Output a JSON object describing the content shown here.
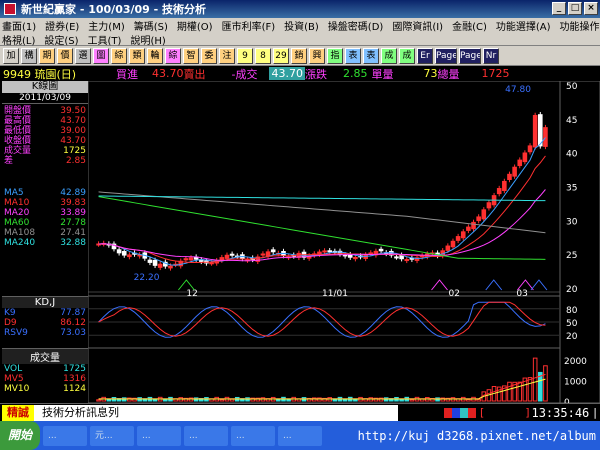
{
  "window": {
    "title": "新世紀贏家 - 100/03/09 - 技術分析"
  },
  "menu": {
    "row1": [
      "畫面(1)",
      "證券(E)",
      "主力(M)",
      "籌碼(S)",
      "期權(O)",
      "匯市利率(F)",
      "投資(B)",
      "操盤密碼(D)",
      "國際資訊(I)",
      "金融(C)",
      "功能選擇(A)",
      "功能操作(E)"
    ],
    "row2": [
      "格視(L)",
      "設定(S)",
      "工具(T)",
      "說明(H)"
    ]
  },
  "toolbar": {
    "buttons": [
      "加",
      "構",
      "期",
      "價",
      "選",
      "圖",
      "綜",
      "類",
      "輪",
      "綜",
      "智",
      "委",
      "注",
      "9",
      "8",
      "29",
      "銷",
      "興",
      "指",
      "表",
      "表",
      "成",
      "成",
      "Er",
      "Page",
      "Page",
      "Nr"
    ]
  },
  "quote": {
    "code_name": "9949 琉園(日)",
    "bid_label": "買進",
    "bid_value": "43.70",
    "ask_label": "賣出",
    "change": "-成交",
    "last": "43.70",
    "change_label": "漲跌",
    "change_value": "2.85",
    "volume_label": "單量",
    "volume_value": "73",
    "total_label": "總量",
    "total_value": "1725"
  },
  "info": {
    "kline_label": "K線圖",
    "date": "2011/03/09",
    "rows": [
      {
        "label": "開盤價",
        "value": "39.50"
      },
      {
        "label": "最高價",
        "value": "43.70"
      },
      {
        "label": "最低價",
        "value": "39.00"
      },
      {
        "label": "收盤價",
        "value": "43.70"
      },
      {
        "label": "成交量",
        "value": "1725"
      },
      {
        "label": "差",
        "value": "2.85"
      }
    ],
    "ma": [
      {
        "label": "MA5",
        "value": "42.89",
        "color": "#3aa0ff"
      },
      {
        "label": "MA10",
        "value": "39.83",
        "color": "#ff3030"
      },
      {
        "label": "MA20",
        "value": "33.89",
        "color": "#ff40ff"
      },
      {
        "label": "MA60",
        "value": "27.78",
        "color": "#30e030"
      },
      {
        "label": "MA108",
        "value": "27.41",
        "color": "#909090"
      },
      {
        "label": "MA240",
        "value": "32.88",
        "color": "#30e0e0"
      }
    ]
  },
  "kd": {
    "title": "KD,J",
    "rows": [
      {
        "label": "K9",
        "value": "77.87",
        "color": "#3a70ff"
      },
      {
        "label": "D9",
        "value": "86.12",
        "color": "#ff3030"
      },
      {
        "label": "RSV9",
        "value": "73.03",
        "color": "#3a70ff"
      }
    ],
    "axis": [
      "80",
      "50",
      "20"
    ]
  },
  "vol": {
    "title": "成交量",
    "rows": [
      {
        "label": "VOL",
        "value": "1725",
        "color": "#30e0e0"
      },
      {
        "label": "MV5",
        "value": "1316",
        "color": "#ff3030"
      },
      {
        "label": "MV10",
        "value": "1124",
        "color": "#ffff40"
      }
    ],
    "axis": [
      "2000",
      "1000",
      "0"
    ]
  },
  "price_axis": [
    "50",
    "45",
    "40",
    "35",
    "30",
    "25",
    "20"
  ],
  "xlabels": [
    "12",
    "11/01",
    "02",
    "03"
  ],
  "annotations": {
    "high": "47.80",
    "low": "22.20"
  },
  "status": {
    "tag": "精誠",
    "message": "技術分析訊息列",
    "clock": "13:35:46"
  },
  "taskbar": {
    "start": "開始",
    "tasks": [
      "...",
      "元...",
      "...",
      "...",
      "...",
      "..."
    ],
    "url": "http://kuj d3268.pixnet.net/album"
  },
  "colors": {
    "up": "#ff3030",
    "down": "#30e0e0",
    "accent": "#ffff00"
  }
}
